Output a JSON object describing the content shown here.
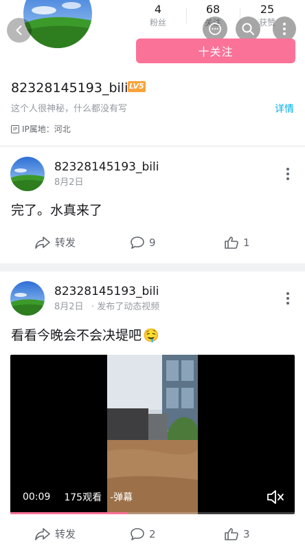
{
  "profile": {
    "stats": [
      {
        "num": "4",
        "label": "粉丝"
      },
      {
        "num": "68",
        "label": "关注"
      },
      {
        "num": "25",
        "label": "获赞"
      }
    ],
    "follow_label": "十关注",
    "username": "82328145193_bili",
    "level": "LV5",
    "bio": "这个人很神秘，什么都没有写",
    "detail_label": "详情",
    "ip_icon_text": "IP",
    "ip_location": "IP属地：河北"
  },
  "posts": [
    {
      "author": "82328145193_bili",
      "date": "8月2日",
      "meta_extra": "",
      "text": "完了。水真来了",
      "share_label": "转发",
      "comments": "9",
      "likes": "1"
    },
    {
      "author": "82328145193_bili",
      "date": "8月2日",
      "meta_extra": "· 发布了动态视频",
      "text": "看看今晚会不会决堤吧",
      "emoji": "🤤",
      "video": {
        "time": "00:09",
        "views": "175观看",
        "danmaku": "-弹幕",
        "progress": 0.41
      },
      "share_label": "转发",
      "comments": "2",
      "likes": "3"
    }
  ],
  "colors": {
    "accent": "#fb7299",
    "link": "#00aeec",
    "level": "#f8a33b"
  }
}
